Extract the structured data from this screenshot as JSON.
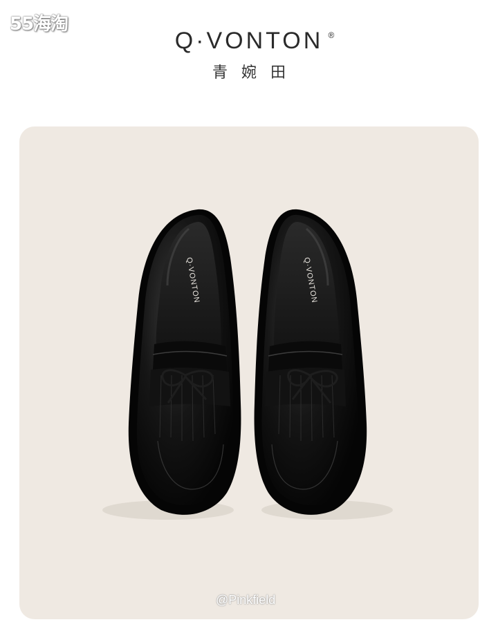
{
  "watermark_top": "55海淘",
  "brand": {
    "name": "Q·VONTON",
    "registered": "®",
    "chinese_name": "青婉田"
  },
  "insole_logo": "Q·VONTON",
  "watermark_bottom": "@Pinkfield",
  "colors": {
    "background": "#ffffff",
    "card": "#efe9e2",
    "shoe": "#0e0e0e",
    "insole": "#1c1c1c",
    "logo_text": "#2a2a2a"
  }
}
